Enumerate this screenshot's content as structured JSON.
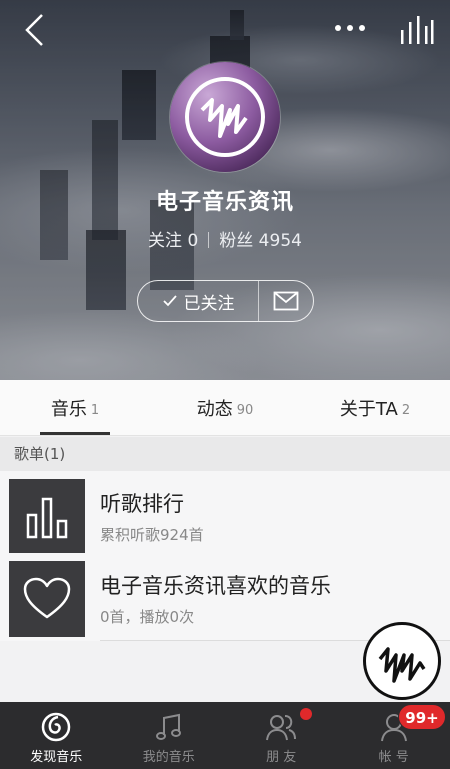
{
  "colors": {
    "accent_red": "#e0292b",
    "nav_bg": "#2c2c2e",
    "list_bg": "#f6f6f7"
  },
  "header": {
    "back_icon": "chevron-left-icon",
    "more_icon": "more-dots-icon",
    "playing_icon": "equalizer-icon"
  },
  "profile": {
    "name": "电子音乐资讯",
    "following": "关注 0",
    "followers": "粉丝 4954",
    "follow_button": "已关注",
    "message_icon": "mail-icon"
  },
  "tabs": [
    {
      "label": "音乐",
      "count": "1",
      "active": true
    },
    {
      "label": "动态",
      "count": "90",
      "active": false
    },
    {
      "label": "关于TA",
      "count": "2",
      "active": false
    }
  ],
  "section": {
    "title": "歌单(1)"
  },
  "list": [
    {
      "title": "听歌排行",
      "subtitle": "累积听歌924首",
      "icon": "bar-chart-icon"
    },
    {
      "title": "电子音乐资讯喜欢的音乐",
      "subtitle": "0首，播放0次",
      "icon": "heart-icon"
    }
  ],
  "bottom_nav": [
    {
      "label": "发现音乐",
      "icon": "netease-music-icon",
      "active": true
    },
    {
      "label": "我的音乐",
      "icon": "music-note-icon",
      "active": false
    },
    {
      "label": "朋 友",
      "icon": "friends-icon",
      "active": false
    },
    {
      "label": "帐 号",
      "icon": "account-icon",
      "active": false
    }
  ],
  "badges": {
    "account": "99+"
  }
}
